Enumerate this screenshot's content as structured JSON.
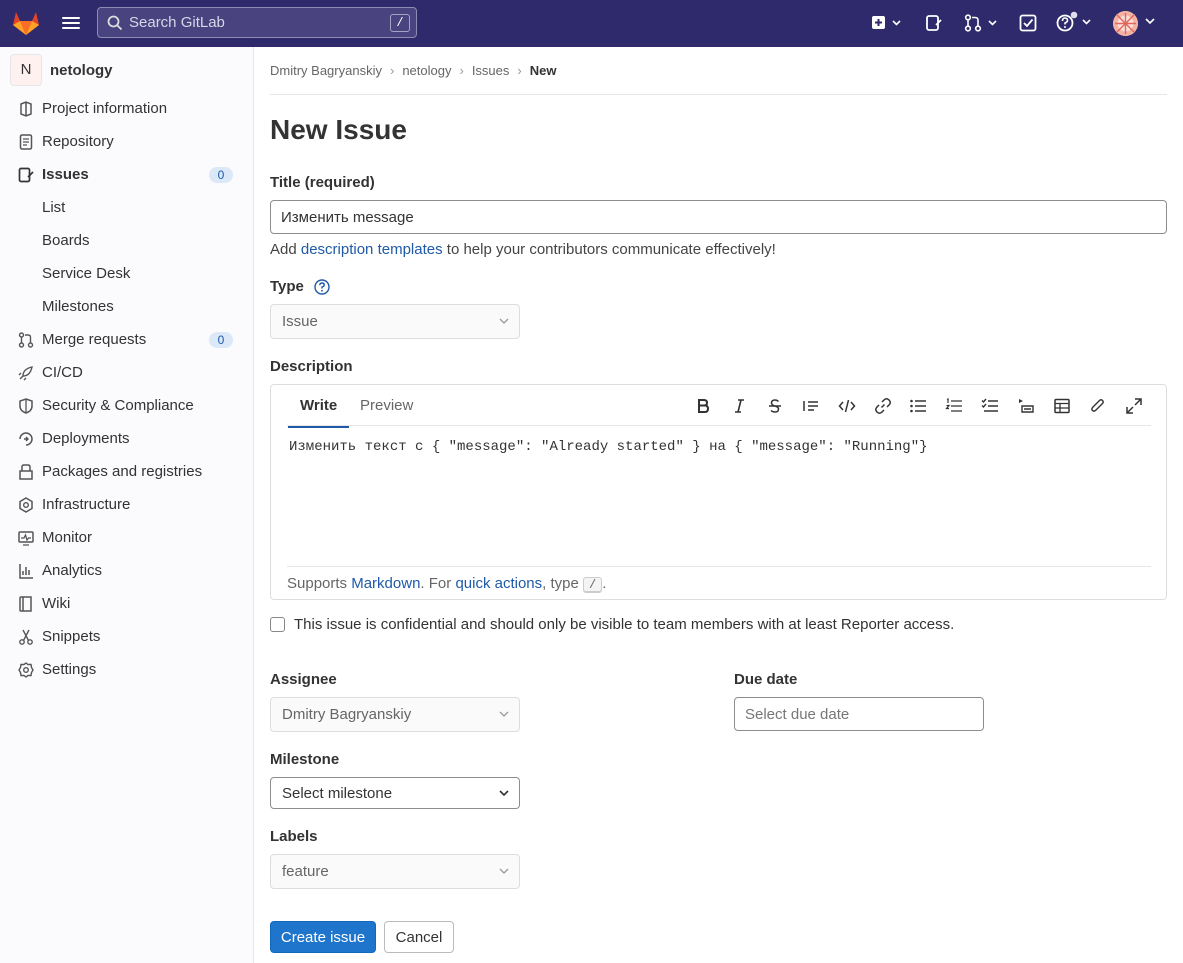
{
  "topbar": {
    "search_placeholder": "Search GitLab",
    "search_shortcut": "/",
    "icons": [
      "gitlab-logo-icon",
      "menu-icon",
      "search-icon",
      "plus-square-icon",
      "issues-icon",
      "merge-request-icon",
      "todo-icon",
      "help-icon",
      "avatar"
    ]
  },
  "sidebar": {
    "project_initial": "N",
    "project_name": "netology",
    "items": [
      {
        "label": "Project information",
        "icon": "project-icon"
      },
      {
        "label": "Repository",
        "icon": "doc-icon"
      },
      {
        "label": "Issues",
        "icon": "issues-icon",
        "count": "0",
        "active": true
      },
      {
        "label": "List"
      },
      {
        "label": "Boards"
      },
      {
        "label": "Service Desk"
      },
      {
        "label": "Milestones"
      },
      {
        "label": "Merge requests",
        "icon": "merge-request-icon",
        "count": "0"
      },
      {
        "label": "CI/CD",
        "icon": "rocket-icon"
      },
      {
        "label": "Security & Compliance",
        "icon": "shield-icon"
      },
      {
        "label": "Deployments",
        "icon": "deployments-icon"
      },
      {
        "label": "Packages and registries",
        "icon": "package-icon"
      },
      {
        "label": "Infrastructure",
        "icon": "infrastructure-icon"
      },
      {
        "label": "Monitor",
        "icon": "monitor-icon"
      },
      {
        "label": "Analytics",
        "icon": "chart-icon"
      },
      {
        "label": "Wiki",
        "icon": "book-icon"
      },
      {
        "label": "Snippets",
        "icon": "scissors-icon"
      },
      {
        "label": "Settings",
        "icon": "settings-icon"
      }
    ]
  },
  "breadcrumb": [
    "Dmitry Bagryanskiy",
    "netology",
    "Issues",
    "New"
  ],
  "page_title": "New Issue",
  "form": {
    "title_label": "Title (required)",
    "title_value": "Изменить message",
    "help_prefix": "Add ",
    "help_link": "description templates",
    "help_suffix": " to help your contributors communicate effectively!",
    "type_label": "Type",
    "type_value": "Issue",
    "description_label": "Description",
    "tab_write": "Write",
    "tab_preview": "Preview",
    "description_text": "Изменить текст с { \"message\": \"Already started\" } на { \"message\": \"Running\"}",
    "footer_prefix": "Supports ",
    "footer_markdown": "Markdown",
    "footer_mid": ". For ",
    "footer_quick": "quick actions",
    "footer_type": ", type ",
    "footer_kbd": "/",
    "footer_end": ".",
    "confidential_text": "This issue is confidential and should only be visible to team members with at least Reporter access.",
    "assignee_label": "Assignee",
    "assignee_value": "Dmitry Bagryanskiy",
    "due_label": "Due date",
    "due_placeholder": "Select due date",
    "milestone_label": "Milestone",
    "milestone_value": "Select milestone",
    "labels_label": "Labels",
    "labels_value": "feature",
    "create_button": "Create issue",
    "cancel_button": "Cancel"
  },
  "colors": {
    "topbar": "#2f2a6b",
    "primary": "#1f75cb",
    "link": "#1f5aa8"
  }
}
